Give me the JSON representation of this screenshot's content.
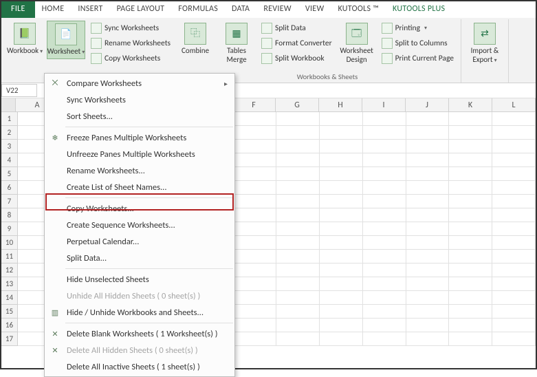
{
  "tabs": {
    "file": "FILE",
    "home": "HOME",
    "insert": "INSERT",
    "page": "PAGE LAYOUT",
    "formulas": "FORMULAS",
    "data": "DATA",
    "review": "REVIEW",
    "view": "VIEW",
    "kutools": "KUTOOLS ™",
    "kutoolsplus": "KUTOOLS PLUS"
  },
  "ribbon": {
    "workbook": "Workbook",
    "worksheet": "Worksheet",
    "sync": "Sync Worksheets",
    "rename": "Rename Worksheets",
    "copy": "Copy Worksheets",
    "combine": "Combine",
    "tables_merge": "Tables\nMerge",
    "split_data": "Split Data",
    "format_converter": "Format Converter",
    "split_workbook": "Split Workbook",
    "worksheet_design": "Worksheet\nDesign",
    "printing": "Printing",
    "split_columns": "Split to Columns",
    "print_current": "Print Current Page",
    "import_export": "Import &\nExport",
    "group_label": "Workbooks & Sheets"
  },
  "namebox": "V22",
  "columns": [
    "A",
    "",
    "",
    "",
    "",
    "F",
    "G",
    "H",
    "I",
    "J",
    "K",
    "L"
  ],
  "rowcount": 17,
  "menu": {
    "compare": "Compare Worksheets",
    "sync": "Sync Worksheets",
    "sort": "Sort Sheets...",
    "freeze": "Freeze Panes Multiple Worksheets",
    "unfreeze": "Unfreeze Panes Multiple Worksheets",
    "rename": "Rename Worksheets...",
    "create_list": "Create List of Sheet Names...",
    "copy": "Copy Worksheets...",
    "create_seq": "Create Sequence Worksheets...",
    "perpetual": "Perpetual Calendar...",
    "split_data": "Split Data...",
    "hide_unselected": "Hide Unselected Sheets",
    "unhide_hidden": "Unhide All Hidden Sheets ( 0 sheet(s) )",
    "hide_unhide_wb": "Hide / Unhide Workbooks and Sheets...",
    "delete_blank": "Delete Blank Worksheets ( 1 Worksheet(s) )",
    "delete_hidden": "Delete All Hidden Sheets ( 0 sheet(s) )",
    "delete_inactive": "Delete All Inactive Sheets ( 1 sheet(s) )"
  }
}
